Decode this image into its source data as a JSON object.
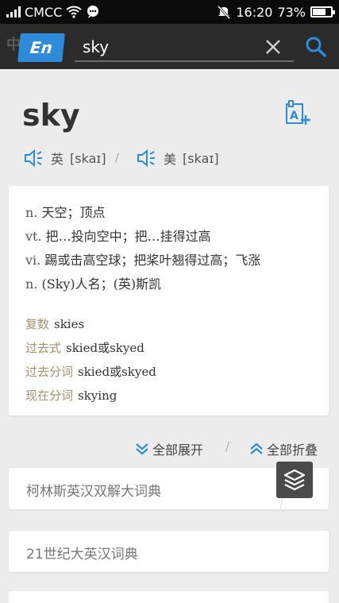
{
  "status": {
    "carrier": "CMCC",
    "time": "16:20",
    "battery": "73%",
    "battery_level": 0.73
  },
  "header": {
    "lang_bg": "中",
    "lang_active": "En",
    "query": "sky",
    "icons": {
      "clear": "close-icon",
      "search": "search-icon"
    }
  },
  "entry": {
    "word": "sky",
    "pron_uk_label": "英",
    "pron_uk": "[skaɪ]",
    "pron_sep": "/",
    "pron_us_label": "美",
    "pron_us": "[skaɪ]",
    "definitions": [
      {
        "pos": "n.",
        "text": "天空；顶点"
      },
      {
        "pos": "vt.",
        "text": "把…投向空中；把…挂得过高"
      },
      {
        "pos": "vi.",
        "text": "踢或击高空球；把桨叶翘得过高；飞涨"
      },
      {
        "pos": "n.",
        "text": "(Sky)人名；(英)斯凯"
      }
    ],
    "forms": [
      {
        "label": "复数",
        "value": "skies"
      },
      {
        "label": "过去式",
        "value": "skied或skyed"
      },
      {
        "label": "过去分词",
        "value": "skied或skyed"
      },
      {
        "label": "现在分词",
        "value": "skying"
      }
    ]
  },
  "controls": {
    "expand_all": "全部展开",
    "collapse_all": "全部折叠",
    "sep": "/"
  },
  "dictionaries": [
    {
      "name": "柯林斯英汉双解大词典"
    },
    {
      "name": "21世纪大英汉词典"
    }
  ],
  "colors": {
    "accent": "#2e8bd8",
    "form_label": "#a8906c",
    "header_bg": "#2b2b2b"
  }
}
